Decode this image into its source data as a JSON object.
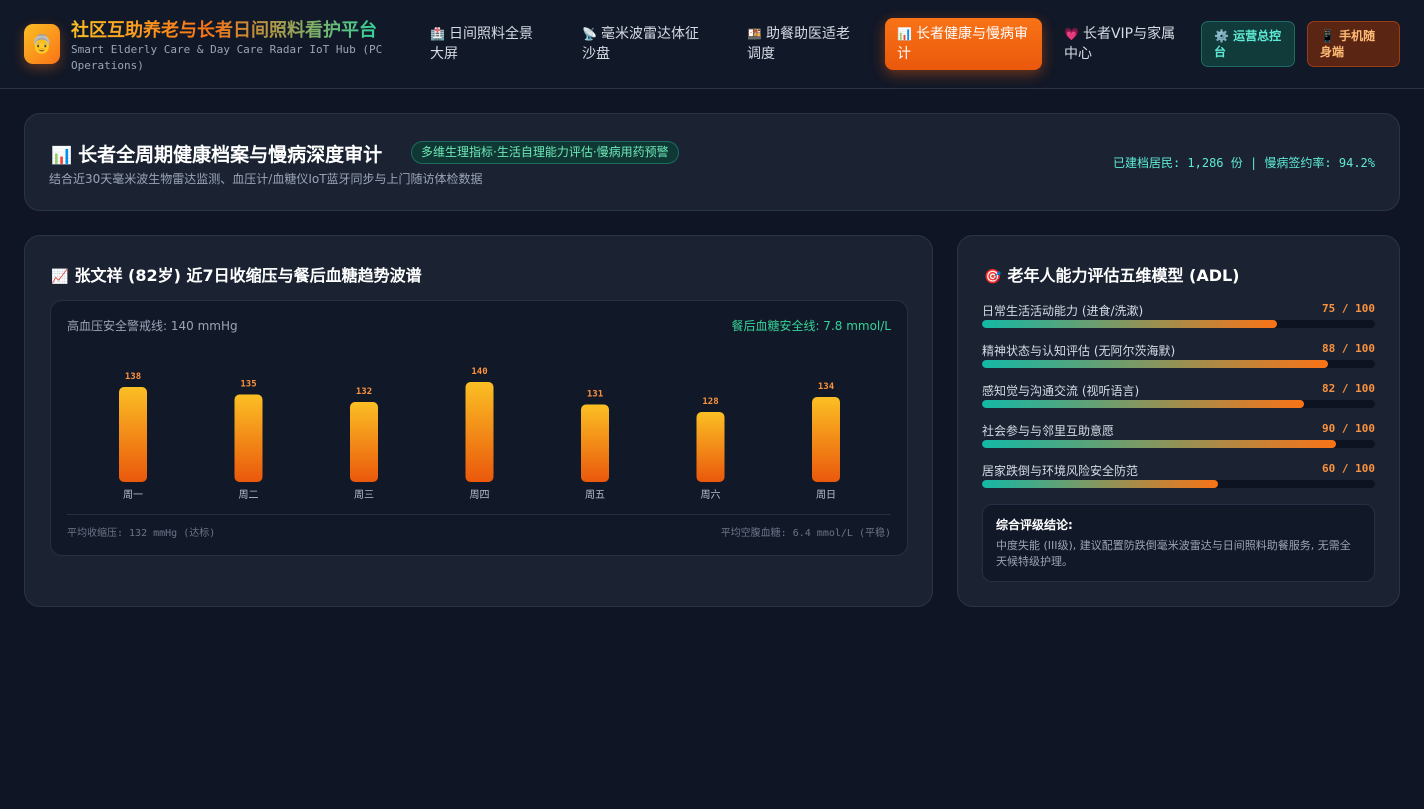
{
  "header": {
    "logo_glyph": "👵",
    "brand_title": "社区互助养老与长者日间照料看护平台",
    "brand_subtitle": "Smart Elderly Care & Day Care Radar IoT Hub (PC Operations)",
    "nav": [
      {
        "icon": "🏥",
        "label": "日间照料全景大屏"
      },
      {
        "icon": "📡",
        "label": "毫米波雷达体征沙盘"
      },
      {
        "icon": "🍱",
        "label": "助餐助医适老调度"
      },
      {
        "icon": "📊",
        "label": "长者健康与慢病审计"
      },
      {
        "icon": "💗",
        "label": "长者VIP与家属中心"
      }
    ],
    "ops_button": {
      "icon": "⚙️",
      "label": "运营总控台"
    },
    "mobile_button": {
      "icon": "📱",
      "label": "手机随身端"
    }
  },
  "hero": {
    "icon": "📊",
    "title": "长者全周期健康档案与慢病深度审计",
    "tag": "多维生理指标·生活自理能力评估·慢病用药预警",
    "subtitle": "结合近30天毫米波生物雷达监测、血压计/血糖仪IoT蓝牙同步与上门随访体检数据",
    "stats": "已建档居民: 1,286 份 | 慢病签约率: 94.2%"
  },
  "trend": {
    "icon": "📈",
    "title": "张文祥 (82岁) 近7日收缩压与餐后血糖趋势波谱",
    "ref_left": "高血压安全警戒线: 140 mmHg",
    "ref_right": "餐后血糖安全线: 7.8 mmol/L",
    "footer_left": "平均收缩压: 132 mmHg (达标)",
    "footer_right": "平均空腹血糖: 6.4 mmol/L (平稳)"
  },
  "chart_data": {
    "type": "bar",
    "categories": [
      "周一",
      "周二",
      "周三",
      "周四",
      "周五",
      "周六",
      "周日"
    ],
    "values": [
      138,
      135,
      132,
      140,
      131,
      128,
      134
    ]
  },
  "adl": {
    "icon": "🎯",
    "title": "老年人能力评估五维模型 (ADL)",
    "items": [
      {
        "label": "日常生活活动能力 (进食/洗漱)",
        "score": "75 / 100",
        "value": 75
      },
      {
        "label": "精神状态与认知评估 (无阿尔茨海默)",
        "score": "88 / 100",
        "value": 88
      },
      {
        "label": "感知觉与沟通交流 (视听语言)",
        "score": "82 / 100",
        "value": 82
      },
      {
        "label": "社会参与与邻里互助意愿",
        "score": "90 / 100",
        "value": 90
      },
      {
        "label": "居家跌倒与环境风险安全防范",
        "score": "60 / 100",
        "value": 60
      }
    ],
    "conclusion_title": "综合评级结论:",
    "conclusion_text": "中度失能 (III级), 建议配置防跌倒毫米波雷达与日间照料助餐服务, 无需全天候特级护理。"
  },
  "colors": {
    "accent": "#f97316",
    "teal": "#14b8a6",
    "background": "#0f1524",
    "card": "#1b2333"
  }
}
